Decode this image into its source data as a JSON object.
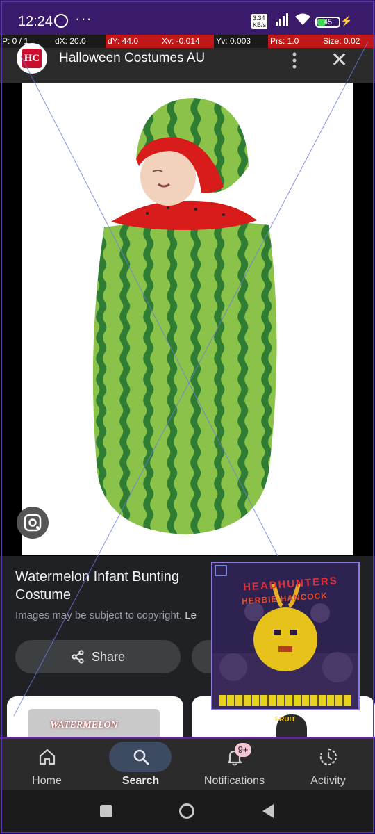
{
  "status_bar": {
    "time": "12:24",
    "overflow": "···",
    "net_speed": "3.34\nKB/s",
    "battery": "45",
    "icons": [
      "whatsapp-icon",
      "signal-icon",
      "wifi-icon",
      "battery-icon",
      "charging-icon"
    ]
  },
  "debug_bar": {
    "pointer": "P: 0 / 1",
    "dx": "dX: 20.0",
    "dy": "dY: 44.0",
    "xv": "Xv: -0.014",
    "yv": "Yv: 0.003",
    "prs": "Prs: 1.0",
    "size": "Size: 0.02"
  },
  "header": {
    "logo_text": "HC",
    "site_name": "Halloween Costumes AU"
  },
  "result": {
    "title": "Watermelon Infant Bunting Costume",
    "copyright": "Images may be subject to copyright.",
    "learn_more": "Le",
    "share_label": "Share"
  },
  "related": {
    "card1_label": "WATERMELON",
    "card2_label": "FRUIT"
  },
  "album": {
    "title_line1": "HEADHUNTERS",
    "title_line2": "HERBIE HANCOCK"
  },
  "bottom_nav": {
    "items": [
      {
        "label": "Home",
        "icon": "home-icon"
      },
      {
        "label": "Search",
        "icon": "search-icon"
      },
      {
        "label": "Notifications",
        "icon": "bell-icon"
      },
      {
        "label": "Activity",
        "icon": "activity-icon"
      }
    ],
    "active_index": 1,
    "notification_badge": "9+"
  },
  "colors": {
    "accent_active": "#3c4a62",
    "badge": "#f5c6d6",
    "logo_red": "#c8102e",
    "watermelon_dark": "#2e7d32",
    "watermelon_light": "#8bc34a"
  }
}
